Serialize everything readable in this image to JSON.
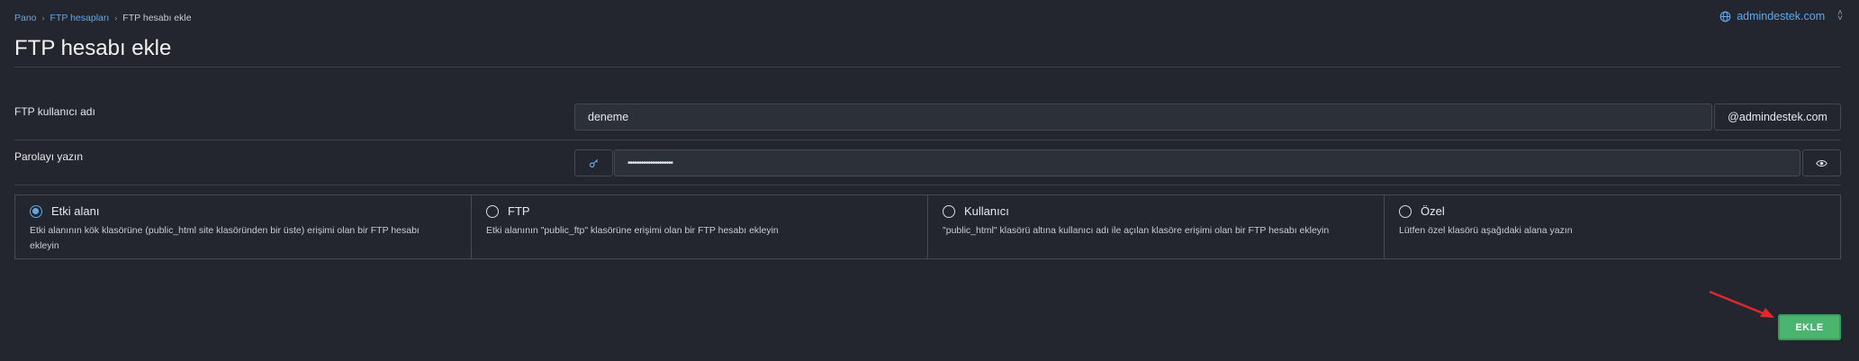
{
  "breadcrumb": {
    "items": [
      "Pano",
      "FTP hesapları"
    ],
    "current": "FTP hesabı ekle"
  },
  "domain_switch": {
    "label": "admindestek.com",
    "icon": "globe-icon"
  },
  "page_title": "FTP hesabı ekle",
  "username": {
    "label": "FTP kullanıcı adı",
    "value": "deneme",
    "suffix": "@admindestek.com"
  },
  "password": {
    "label": "Parolayı yazın",
    "value": "••••••••••••••••••••",
    "generate_icon": "key-icon",
    "toggle_icon": "eye-icon"
  },
  "options": [
    {
      "title": "Etki alanı",
      "desc": "Etki alanının kök klasörüne (public_html site klasöründen bir üste) erişimi olan bir FTP hesabı ekleyin",
      "checked": true
    },
    {
      "title": "FTP",
      "desc": "Etki alanının \"public_ftp\" klasörüne erişimi olan bir FTP hesabı ekleyin",
      "checked": false
    },
    {
      "title": "Kullanıcı",
      "desc": "\"public_html\" klasörü altına kullanıcı adı ile açılan klasöre erişimi olan bir FTP hesabı ekleyin",
      "checked": false
    },
    {
      "title": "Özel",
      "desc": "Lütfen özel klasörü aşağıdaki alana yazın",
      "checked": false
    }
  ],
  "submit_label": "EKLE",
  "colors": {
    "accent": "#5fa8ec",
    "submit": "#4bb46f",
    "arrow": "#e0282e",
    "background": "#23262e"
  }
}
